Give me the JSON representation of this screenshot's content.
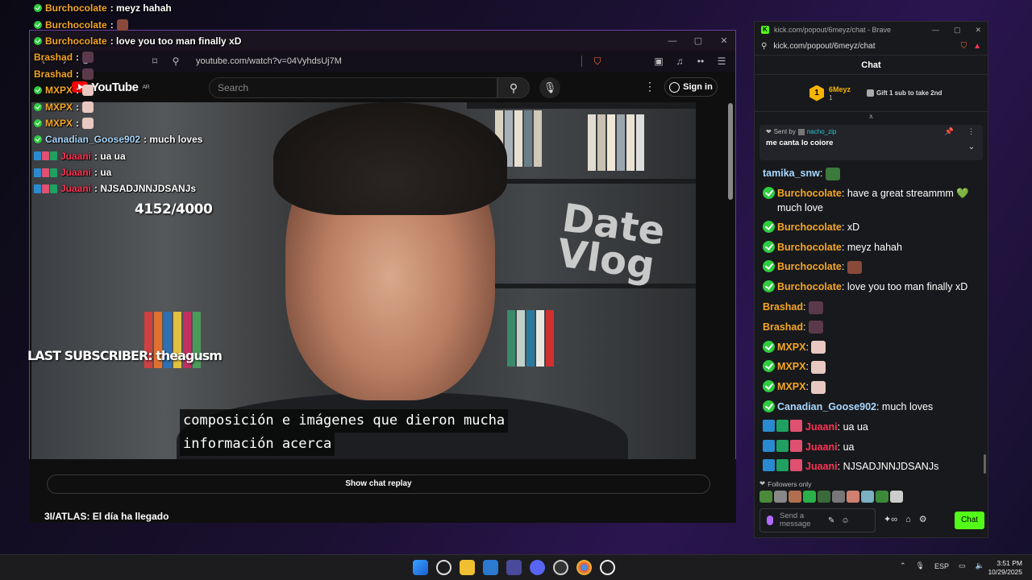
{
  "youtube_window": {
    "url": "youtube.com/watch?v=04VyhdsUj7M",
    "logo_text": "YouTube",
    "logo_region": "AR",
    "search_placeholder": "Search",
    "sign_in_label": "Sign in",
    "caption_line1": "composición e imágenes que dieron mucha",
    "caption_line2": "información acerca",
    "show_chat_replay_label": "Show chat replay",
    "video_title": "3I/ATLAS: El día ha llegado"
  },
  "overlay": {
    "sub_goal": "4152/4000",
    "last_subscriber": "LAST SUBSCRIBER: theagusm",
    "messages": [
      {
        "user": "Burchocolate",
        "text": " : meyz hahah",
        "color": "#f5a623",
        "check": true,
        "emote": ""
      },
      {
        "user": "Burchocolate",
        "text": " : ",
        "color": "#f5a623",
        "check": true,
        "emote": "#8a4a3a"
      },
      {
        "user": "Burchocolate",
        "text": " : love you too man finally xD",
        "color": "#f5a623",
        "check": true,
        "emote": ""
      },
      {
        "user": "Brashad",
        "text": " : ",
        "color": "#f5a623",
        "check": false,
        "emote": "#5a3a4a"
      },
      {
        "user": "Brashad",
        "text": " : ",
        "color": "#f5a623",
        "check": false,
        "emote": "#5a3a4a"
      },
      {
        "user": "MXPX",
        "text": " : ",
        "color": "#f5a623",
        "check": true,
        "emote": "#e8c8c0"
      },
      {
        "user": "MXPX",
        "text": " : ",
        "color": "#f5a623",
        "check": true,
        "emote": "#e8c8c0"
      },
      {
        "user": "MXPX",
        "text": " : ",
        "color": "#f5a623",
        "check": true,
        "emote": "#e8c8c0"
      },
      {
        "user": "Canadian_Goose902",
        "text": " : much loves",
        "color": "#a8d8ff",
        "check": true,
        "emote": ""
      },
      {
        "user": "Juaani",
        "text": " : ua ua",
        "color": "#ff3355",
        "check": false,
        "emote": "",
        "badges": true
      },
      {
        "user": "Juaani",
        "text": " : ua",
        "color": "#ff3355",
        "check": false,
        "emote": "",
        "badges": true
      },
      {
        "user": "Juaani",
        "text": " : NJSADJNNJDSANJs",
        "color": "#ff3355",
        "check": false,
        "emote": "",
        "badges": true
      }
    ]
  },
  "kick_window": {
    "title": "kick.com/popout/6meyz/chat - Brave",
    "url": "kick.com/popout/6meyz/chat",
    "chat_heading": "Chat",
    "top_gifter_rank": "1",
    "top_gifter_name": "6Meyz",
    "top_gifter_count": "1",
    "gift_cta": "Gift 1 sub to take 2nd",
    "pinned_sent_by": "Sent by",
    "pinned_user": "nacho_zip",
    "pinned_message": "me canta lo coiore",
    "messages": [
      {
        "user": "tamika_snw",
        "text": "",
        "color": "#a8d8ff",
        "verified": false,
        "emote": "#3a7a3a",
        "badges": false
      },
      {
        "user": "Burchocolate",
        "text": "have a great streammm",
        "text2": "much love",
        "color": "#f5a623",
        "verified": true,
        "emote": "",
        "heart": "💚",
        "badges": false
      },
      {
        "user": "Burchocolate",
        "text": "xD",
        "color": "#f5a623",
        "verified": true,
        "emote": "",
        "badges": false
      },
      {
        "user": "Burchocolate",
        "text": "meyz hahah",
        "color": "#f5a623",
        "verified": true,
        "emote": "",
        "badges": false
      },
      {
        "user": "Burchocolate",
        "text": "",
        "color": "#f5a623",
        "verified": true,
        "emote": "#8a4a3a",
        "badges": false
      },
      {
        "user": "Burchocolate",
        "text": "love you too man finally xD",
        "color": "#f5a623",
        "verified": true,
        "emote": "",
        "badges": false
      },
      {
        "user": "Brashad",
        "text": "",
        "color": "#f5a623",
        "verified": false,
        "emote": "#5a3a4a",
        "badges": false
      },
      {
        "user": "Brashad",
        "text": "",
        "color": "#f5a623",
        "verified": false,
        "emote": "#5a3a4a",
        "badges": false
      },
      {
        "user": "MXPX",
        "text": "",
        "color": "#f5a623",
        "verified": true,
        "emote": "#e8c8c0",
        "badges": false
      },
      {
        "user": "MXPX",
        "text": "",
        "color": "#f5a623",
        "verified": true,
        "emote": "#e8c8c0",
        "badges": false
      },
      {
        "user": "MXPX",
        "text": "",
        "color": "#f5a623",
        "verified": true,
        "emote": "#e8c8c0",
        "badges": false
      },
      {
        "user": "Canadian_Goose902",
        "text": "much loves",
        "color": "#a8d8ff",
        "verified": true,
        "emote": "",
        "badges": false
      },
      {
        "user": "Juaani",
        "text": "ua ua",
        "color": "#ff3355",
        "verified": false,
        "emote": "",
        "badges": true
      },
      {
        "user": "Juaani",
        "text": "ua",
        "color": "#ff3355",
        "verified": false,
        "emote": "",
        "badges": true
      },
      {
        "user": "Juaani",
        "text": "NJSADJNNJDSANJs",
        "color": "#ff3355",
        "verified": false,
        "emote": "",
        "badges": true
      }
    ],
    "followers_only": "Followers only",
    "send_placeholder": "Send a message",
    "chat_button": "Chat"
  },
  "taskbar": {
    "language": "ESP",
    "time": "3:51 PM",
    "date": "10/29/2025"
  },
  "colors": {
    "kick_green": "#53fc18",
    "youtube_red": "#ff0000",
    "window_border": "#6b3fa0"
  }
}
